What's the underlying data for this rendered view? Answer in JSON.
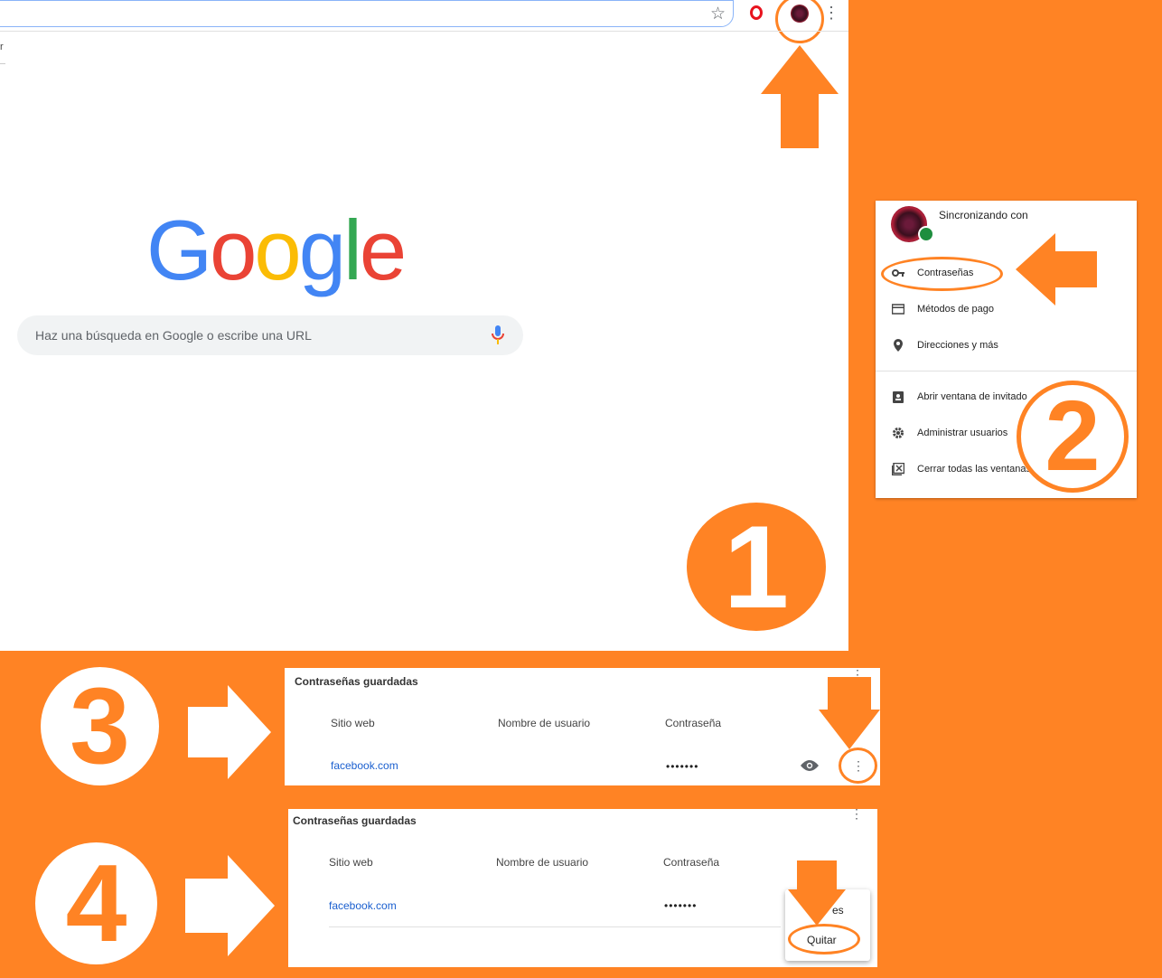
{
  "colors": {
    "accent_orange": "#FF8324",
    "link_blue": "#1a5fcf"
  },
  "browser": {
    "fragment_text": "r",
    "star_icon": "☆",
    "menu_icon": "⋮",
    "logo_letters": [
      {
        "ch": "G",
        "color": "#4285F4"
      },
      {
        "ch": "o",
        "color": "#EA4335"
      },
      {
        "ch": "o",
        "color": "#FBBC05"
      },
      {
        "ch": "g",
        "color": "#4285F4"
      },
      {
        "ch": "l",
        "color": "#34A853"
      },
      {
        "ch": "e",
        "color": "#EA4335"
      }
    ],
    "search_placeholder": "Haz una búsqueda en Google o escribe una URL"
  },
  "steps": [
    "1",
    "2",
    "3",
    "4"
  ],
  "profile_menu": {
    "sync_text": "Sincronizando con",
    "items": [
      {
        "label": "Contraseñas",
        "icon": "key-icon"
      },
      {
        "label": "Métodos de pago",
        "icon": "credit-card-icon"
      },
      {
        "label": "Direcciones y más",
        "icon": "location-pin-icon"
      },
      {
        "label": "Abrir ventana de invitado",
        "icon": "guest-badge-icon"
      },
      {
        "label": "Administrar usuarios",
        "icon": "gear-icon"
      },
      {
        "label": "Cerrar todas las ventanas",
        "icon": "close-window-icon"
      }
    ]
  },
  "saved_passwords": {
    "title": "Contraseñas guardadas",
    "columns": [
      "Sitio web",
      "Nombre de usuario",
      "Contraseña"
    ],
    "rows": [
      {
        "site": "facebook.com",
        "username": "",
        "password": "•••••••"
      }
    ]
  },
  "row_menu": {
    "partial_item": "es",
    "remove": "Quitar"
  }
}
